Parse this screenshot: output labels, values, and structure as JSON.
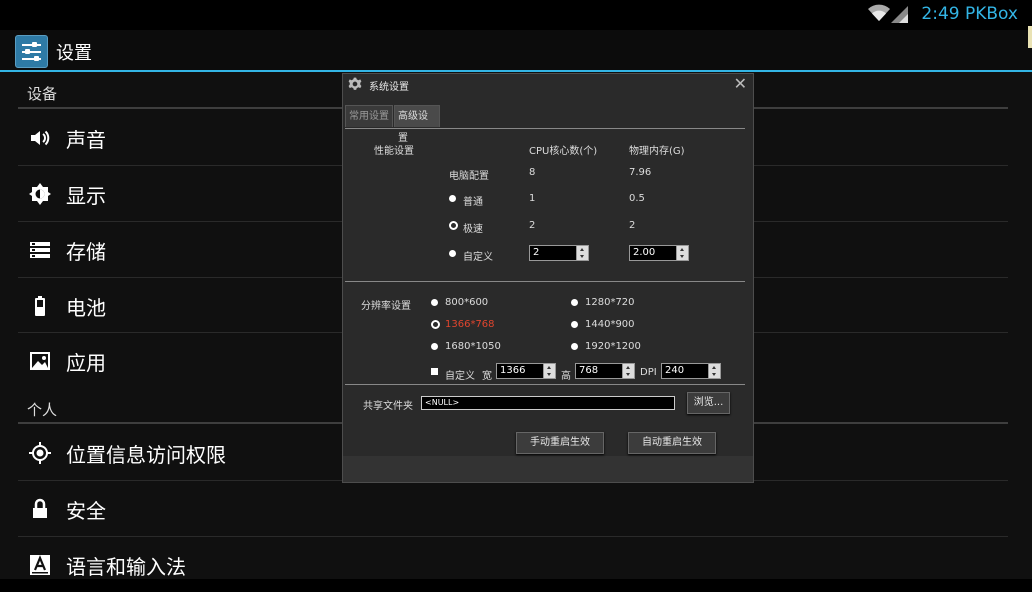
{
  "status_bar": {
    "time": "2:49 PKBox"
  },
  "action_bar": {
    "title": "设置"
  },
  "settings": {
    "section_device": "设备",
    "section_personal": "个人",
    "items": [
      {
        "label": "声音",
        "icon": "volume-icon"
      },
      {
        "label": "显示",
        "icon": "brightness-icon"
      },
      {
        "label": "存储",
        "icon": "storage-icon"
      },
      {
        "label": "电池",
        "icon": "battery-icon"
      },
      {
        "label": "应用",
        "icon": "apps-icon"
      },
      {
        "label": "位置信息访问权限",
        "icon": "location-icon"
      },
      {
        "label": "安全",
        "icon": "lock-icon"
      },
      {
        "label": "语言和输入法",
        "icon": "language-icon"
      }
    ]
  },
  "dialog": {
    "title": "系统设置",
    "close": "✕",
    "tabs": [
      "常用设置",
      "高级设置"
    ],
    "performance": {
      "label": "性能设置",
      "col_cpu": "CPU核心数(个)",
      "col_mem": "物理内存(G)",
      "rows": [
        {
          "label": "电脑配置",
          "cpu": "8",
          "mem": "7.96"
        },
        {
          "label": "普通",
          "cpu": "1",
          "mem": "0.5"
        },
        {
          "label": "极速",
          "cpu": "2",
          "mem": "2"
        },
        {
          "label": "自定义",
          "cpu": "2",
          "mem": "2.00"
        }
      ]
    },
    "resolution": {
      "label": "分辨率设置",
      "options": [
        "800*600",
        "1280*720",
        "1366*768",
        "1440*900",
        "1680*1050",
        "1920*1200"
      ],
      "selected": "1366*768",
      "custom_label": "自定义",
      "width_label": "宽",
      "width_value": "1366",
      "height_label": "高",
      "height_value": "768",
      "dpi_label": "DPI",
      "dpi_value": "240"
    },
    "shared_folder": {
      "label": "共享文件夹",
      "value": "<NULL>",
      "browse": "浏览..."
    },
    "buttons": {
      "manual": "手动重启生效",
      "auto": "自动重启生效"
    },
    "colors": {
      "selected": "#e0452e",
      "accent": "#33b5e5"
    }
  }
}
